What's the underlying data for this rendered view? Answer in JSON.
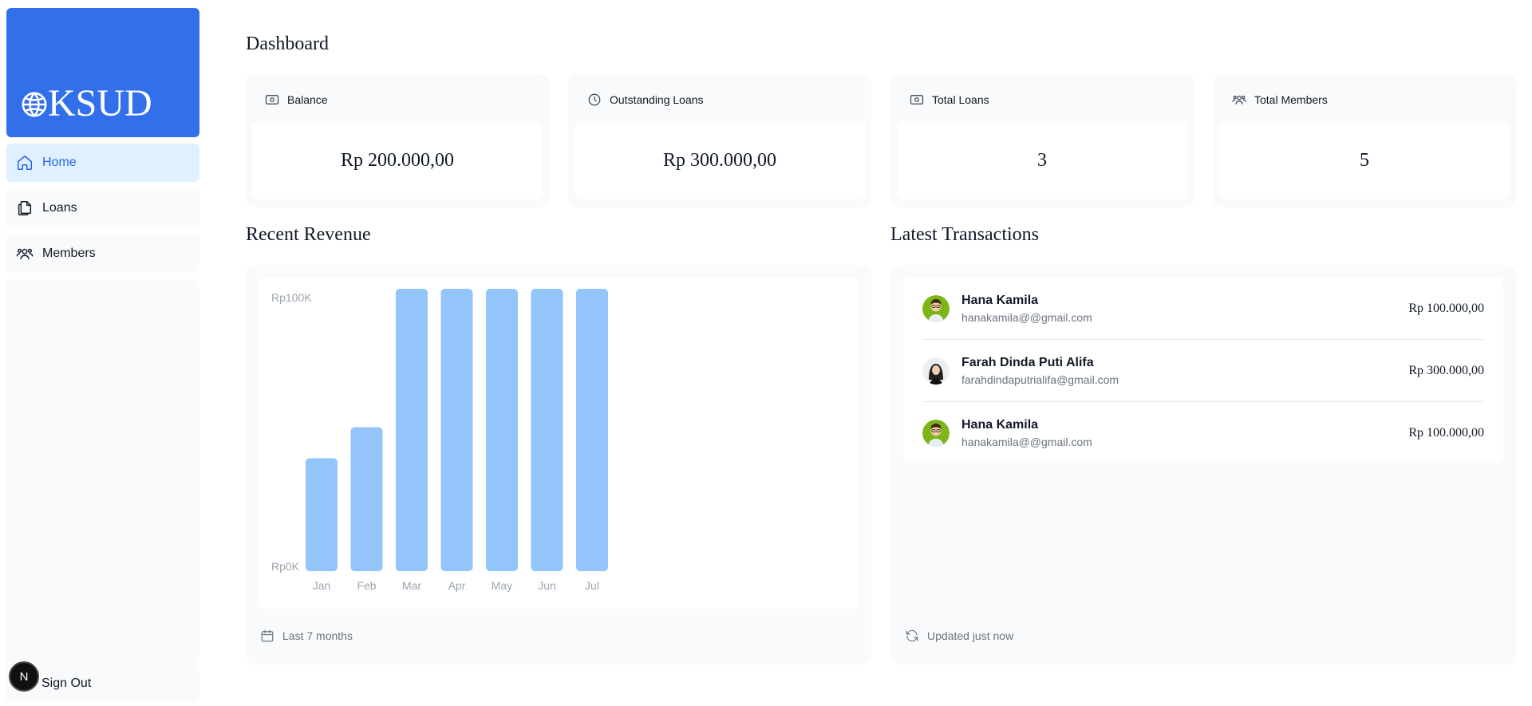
{
  "brand": {
    "name": "KSUD",
    "accent": "#3170ea"
  },
  "sidebar": {
    "items": [
      {
        "label": "Home",
        "icon": "home-icon",
        "active": true
      },
      {
        "label": "Loans",
        "icon": "documents-icon",
        "active": false
      },
      {
        "label": "Members",
        "icon": "users-icon",
        "active": false
      }
    ],
    "signout_label": "Sign Out",
    "badge_letter": "N"
  },
  "page": {
    "title": "Dashboard"
  },
  "stats": [
    {
      "label": "Balance",
      "icon": "banknote-icon",
      "value": "Rp 200.000,00"
    },
    {
      "label": "Outstanding Loans",
      "icon": "clock-icon",
      "value": "Rp 300.000,00"
    },
    {
      "label": "Total Loans",
      "icon": "banknote-icon",
      "value": "3"
    },
    {
      "label": "Total Members",
      "icon": "users-icon",
      "value": "5"
    }
  ],
  "revenue": {
    "title": "Recent Revenue",
    "footer": "Last 7 months",
    "footer_icon": "calendar-icon"
  },
  "transactions": {
    "title": "Latest Transactions",
    "footer": "Updated just now",
    "footer_icon": "refresh-icon",
    "items": [
      {
        "name": "Hana Kamila",
        "email": "hanakamila@@gmail.com",
        "amount": "Rp 100.000,00",
        "avatar": "avatar-man"
      },
      {
        "name": "Farah Dinda Puti Alifa",
        "email": "farahdindaputrialifa@gmail.com",
        "amount": "Rp 300.000,00",
        "avatar": "avatar-woman"
      },
      {
        "name": "Hana Kamila",
        "email": "hanakamila@@gmail.com",
        "amount": "Rp 100.000,00",
        "avatar": "avatar-man"
      }
    ]
  },
  "chart_data": {
    "type": "bar",
    "categories": [
      "Jan",
      "Feb",
      "Mar",
      "Apr",
      "May",
      "Jun",
      "Jul"
    ],
    "values": [
      40,
      51,
      100,
      100,
      100,
      100,
      100
    ],
    "title": "",
    "xlabel": "",
    "ylabel": "",
    "ylim": [
      0,
      100
    ],
    "ytick_labels": [
      "Rp0K",
      "Rp100K"
    ],
    "bar_color": "#93c5fb",
    "grid": false
  }
}
